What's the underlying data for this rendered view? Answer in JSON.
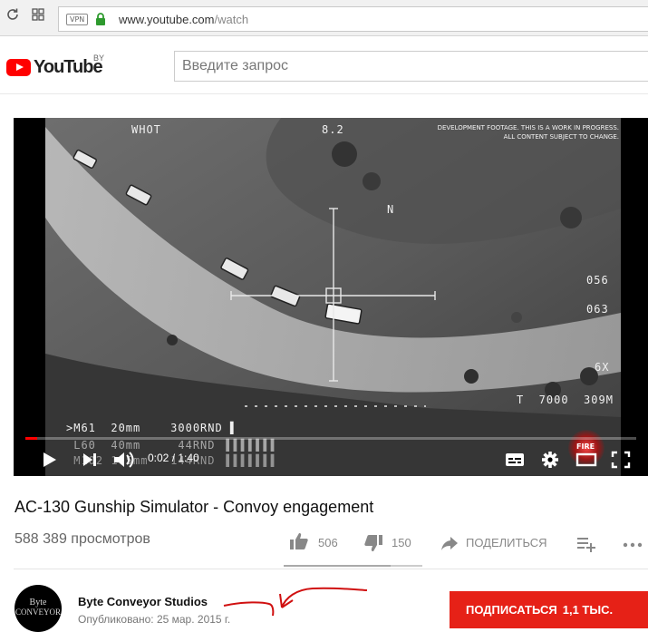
{
  "browser": {
    "vpn_label": "VPN",
    "url_host": "www.youtube.com",
    "url_path": "/watch"
  },
  "header": {
    "logo_text": "YouTube",
    "region": "BY",
    "search_placeholder": "Введите запрос"
  },
  "player": {
    "hud": {
      "mode": "WHOT",
      "zoom": "8.2",
      "north": "N",
      "r1": "056",
      "r2": "063",
      "magnification": "6X",
      "target": "T  7000  309M",
      "weapon_lines": [
        ">M61  20mm    3000RND ▌",
        " L60  40mm     44RND ▐▐▐▐▐▐▐",
        " M102 105mm   144RND ▐▐▐▐▐▐▐"
      ],
      "fire_label": "FIRE"
    },
    "dev_note_line1": "DEVELOPMENT FOOTAGE. THIS IS A WORK IN PROGRESS.",
    "dev_note_line2": "ALL CONTENT SUBJECT TO CHANGE.",
    "time_display": "0:02 / 1:40",
    "progress_fraction": 0.02
  },
  "video": {
    "title": "AC-130 Gunship Simulator - Convoy engagement",
    "views": "588 389 просмотров",
    "likes": "506",
    "dislikes": "150",
    "share_label": "ПОДЕЛИТЬСЯ",
    "like_fraction": 0.77
  },
  "channel": {
    "avatar_text_line1": "Byte",
    "avatar_text_line2": "Conveyor",
    "name": "Byte Conveyor Studios",
    "published": "Опубликовано: 25 мар. 2015 г.",
    "subscribe_label": "ПОДПИСАТЬСЯ",
    "subscriber_count": "1,1 ТЫС."
  },
  "colors": {
    "youtube_red": "#ff0000",
    "subscribe_red": "#e62117",
    "annotation_red": "#d01010"
  }
}
